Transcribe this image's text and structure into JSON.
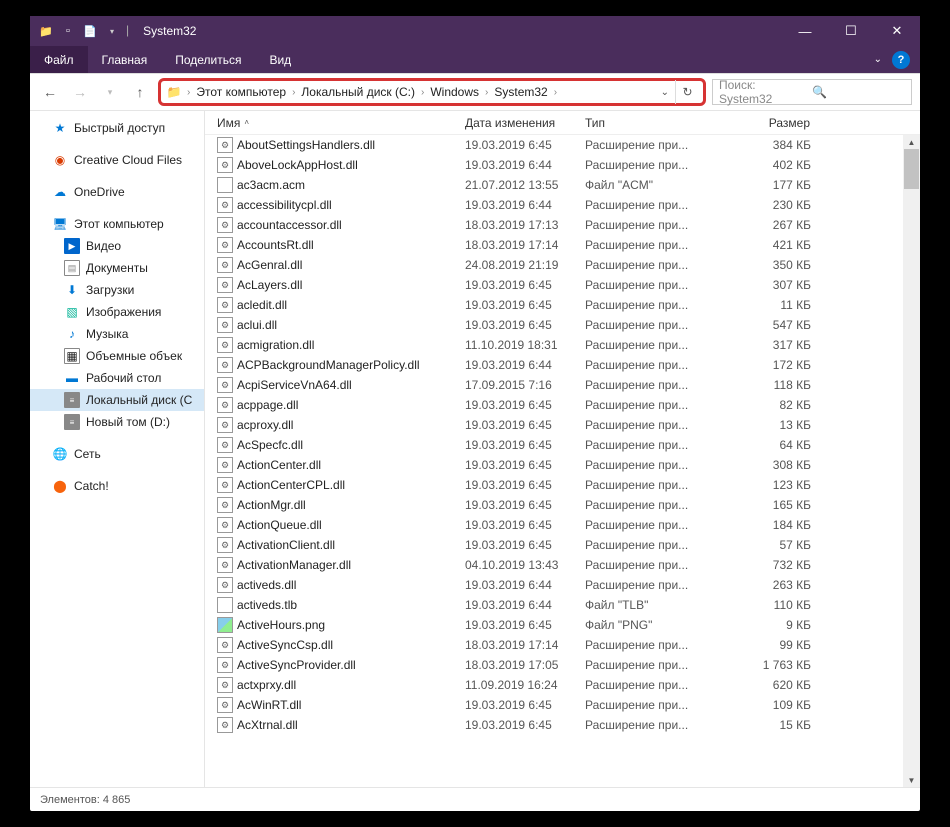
{
  "window": {
    "title": "System32"
  },
  "ribbon": {
    "file": "Файл",
    "tabs": [
      "Главная",
      "Поделиться",
      "Вид"
    ]
  },
  "breadcrumb": {
    "items": [
      "Этот компьютер",
      "Локальный диск (C:)",
      "Windows",
      "System32"
    ]
  },
  "search": {
    "placeholder": "Поиск: System32"
  },
  "sidebar": {
    "quick": "Быстрый доступ",
    "cc": "Creative Cloud Files",
    "onedrive": "OneDrive",
    "thispc": "Этот компьютер",
    "sub": [
      {
        "l": "Видео",
        "ic": "vid"
      },
      {
        "l": "Документы",
        "ic": "doc"
      },
      {
        "l": "Загрузки",
        "ic": "dl"
      },
      {
        "l": "Изображения",
        "ic": "img"
      },
      {
        "l": "Музыка",
        "ic": "mus"
      },
      {
        "l": "Объемные объек",
        "ic": "obj"
      },
      {
        "l": "Рабочий стол",
        "ic": "desk"
      },
      {
        "l": "Локальный диск (С",
        "ic": "drive",
        "sel": true
      },
      {
        "l": "Новый том (D:)",
        "ic": "drive"
      }
    ],
    "network": "Сеть",
    "catch": "Catch!"
  },
  "columns": {
    "name": "Имя",
    "date": "Дата изменения",
    "type": "Тип",
    "size": "Размер"
  },
  "files": [
    {
      "n": "AboutSettingsHandlers.dll",
      "d": "19.03.2019 6:45",
      "t": "Расширение при...",
      "s": "384 КБ",
      "i": "dll"
    },
    {
      "n": "AboveLockAppHost.dll",
      "d": "19.03.2019 6:44",
      "t": "Расширение при...",
      "s": "402 КБ",
      "i": "dll"
    },
    {
      "n": "ac3acm.acm",
      "d": "21.07.2012 13:55",
      "t": "Файл \"ACM\"",
      "s": "177 КБ",
      "i": "gen"
    },
    {
      "n": "accessibilitycpl.dll",
      "d": "19.03.2019 6:44",
      "t": "Расширение при...",
      "s": "230 КБ",
      "i": "dll"
    },
    {
      "n": "accountaccessor.dll",
      "d": "18.03.2019 17:13",
      "t": "Расширение при...",
      "s": "267 КБ",
      "i": "dll"
    },
    {
      "n": "AccountsRt.dll",
      "d": "18.03.2019 17:14",
      "t": "Расширение при...",
      "s": "421 КБ",
      "i": "dll"
    },
    {
      "n": "AcGenral.dll",
      "d": "24.08.2019 21:19",
      "t": "Расширение при...",
      "s": "350 КБ",
      "i": "dll"
    },
    {
      "n": "AcLayers.dll",
      "d": "19.03.2019 6:45",
      "t": "Расширение при...",
      "s": "307 КБ",
      "i": "dll"
    },
    {
      "n": "acledit.dll",
      "d": "19.03.2019 6:45",
      "t": "Расширение при...",
      "s": "11 КБ",
      "i": "dll"
    },
    {
      "n": "aclui.dll",
      "d": "19.03.2019 6:45",
      "t": "Расширение при...",
      "s": "547 КБ",
      "i": "dll"
    },
    {
      "n": "acmigration.dll",
      "d": "11.10.2019 18:31",
      "t": "Расширение при...",
      "s": "317 КБ",
      "i": "dll"
    },
    {
      "n": "ACPBackgroundManagerPolicy.dll",
      "d": "19.03.2019 6:44",
      "t": "Расширение при...",
      "s": "172 КБ",
      "i": "dll"
    },
    {
      "n": "AcpiServiceVnA64.dll",
      "d": "17.09.2015 7:16",
      "t": "Расширение при...",
      "s": "118 КБ",
      "i": "dll"
    },
    {
      "n": "acppage.dll",
      "d": "19.03.2019 6:45",
      "t": "Расширение при...",
      "s": "82 КБ",
      "i": "dll"
    },
    {
      "n": "acproxy.dll",
      "d": "19.03.2019 6:45",
      "t": "Расширение при...",
      "s": "13 КБ",
      "i": "dll"
    },
    {
      "n": "AcSpecfc.dll",
      "d": "19.03.2019 6:45",
      "t": "Расширение при...",
      "s": "64 КБ",
      "i": "dll"
    },
    {
      "n": "ActionCenter.dll",
      "d": "19.03.2019 6:45",
      "t": "Расширение при...",
      "s": "308 КБ",
      "i": "dll"
    },
    {
      "n": "ActionCenterCPL.dll",
      "d": "19.03.2019 6:45",
      "t": "Расширение при...",
      "s": "123 КБ",
      "i": "dll"
    },
    {
      "n": "ActionMgr.dll",
      "d": "19.03.2019 6:45",
      "t": "Расширение при...",
      "s": "165 КБ",
      "i": "dll"
    },
    {
      "n": "ActionQueue.dll",
      "d": "19.03.2019 6:45",
      "t": "Расширение при...",
      "s": "184 КБ",
      "i": "dll"
    },
    {
      "n": "ActivationClient.dll",
      "d": "19.03.2019 6:45",
      "t": "Расширение при...",
      "s": "57 КБ",
      "i": "dll"
    },
    {
      "n": "ActivationManager.dll",
      "d": "04.10.2019 13:43",
      "t": "Расширение при...",
      "s": "732 КБ",
      "i": "dll"
    },
    {
      "n": "activeds.dll",
      "d": "19.03.2019 6:44",
      "t": "Расширение при...",
      "s": "263 КБ",
      "i": "dll"
    },
    {
      "n": "activeds.tlb",
      "d": "19.03.2019 6:44",
      "t": "Файл \"TLB\"",
      "s": "110 КБ",
      "i": "gen"
    },
    {
      "n": "ActiveHours.png",
      "d": "19.03.2019 6:45",
      "t": "Файл \"PNG\"",
      "s": "9 КБ",
      "i": "png"
    },
    {
      "n": "ActiveSyncCsp.dll",
      "d": "18.03.2019 17:14",
      "t": "Расширение при...",
      "s": "99 КБ",
      "i": "dll"
    },
    {
      "n": "ActiveSyncProvider.dll",
      "d": "18.03.2019 17:05",
      "t": "Расширение при...",
      "s": "1 763 КБ",
      "i": "dll"
    },
    {
      "n": "actxprxy.dll",
      "d": "11.09.2019 16:24",
      "t": "Расширение при...",
      "s": "620 КБ",
      "i": "dll"
    },
    {
      "n": "AcWinRT.dll",
      "d": "19.03.2019 6:45",
      "t": "Расширение при...",
      "s": "109 КБ",
      "i": "dll"
    },
    {
      "n": "AcXtrnal.dll",
      "d": "19.03.2019 6:45",
      "t": "Расширение при...",
      "s": "15 КБ",
      "i": "dll"
    }
  ],
  "status": {
    "elements_label": "Элементов:",
    "count": "4 865"
  }
}
